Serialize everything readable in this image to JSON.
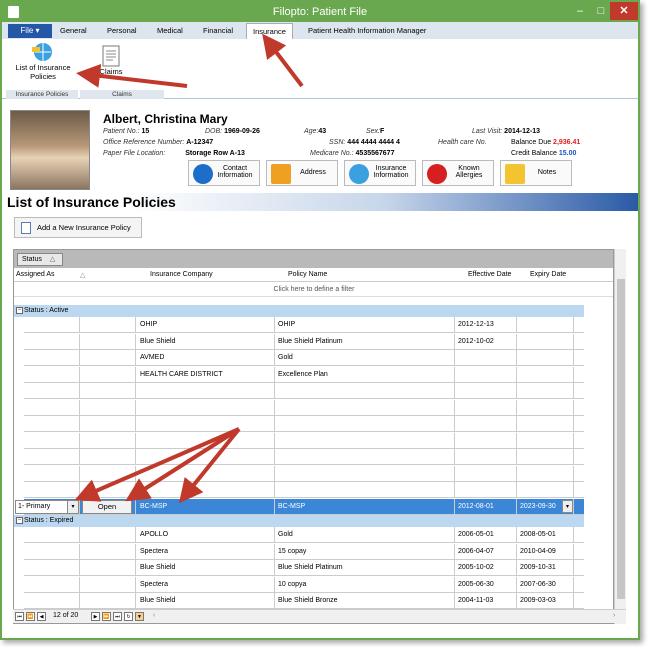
{
  "window": {
    "title": "Filopto: Patient File",
    "minimize": "–",
    "maximize": "□",
    "close": "✕"
  },
  "ribbon": {
    "file_label": "File ▾",
    "tabs": [
      "General",
      "Personal",
      "Medical",
      "Financial",
      "Insurance",
      "Patient Health Information Manager"
    ],
    "active_tab": "Insurance",
    "buttons": {
      "list_policies": "List of Insurance Policies",
      "claims": "Claims"
    },
    "groups": {
      "policies": "Insurance Policies",
      "claims": "Claims"
    }
  },
  "patient": {
    "name": "Albert, Christina Mary",
    "patient_no_label": "Patient No.:",
    "patient_no": "15",
    "dob_label": "DOB:",
    "dob": "1969-09-26",
    "age_label": "Age:",
    "age": "43",
    "sex_label": "Sex:",
    "sex": "F",
    "last_visit_label": "Last Visit:",
    "last_visit": "2014-12-13",
    "office_ref_label": "Office Reference Number:",
    "office_ref": "A-12347",
    "ssn_label": "SSN:",
    "ssn": "444 4444 4444 4",
    "health_card_label": "Health care No.",
    "balance_due_label": "Balance Due",
    "balance_due": "2,936.41",
    "paper_file_label": "Paper File Location:",
    "paper_file": "Storage Row A-13",
    "medicare_label": "Medicare No.:",
    "medicare": "4535567677",
    "credit_label": "Credit Balance",
    "credit": "15.00",
    "buttons": {
      "contact": "Contact Information",
      "address": "Address",
      "insurance": "Insurance Information",
      "allergies": "Known Allergies",
      "notes": "Notes"
    },
    "colors": {
      "balance_due": "#e02020",
      "credit": "#1a4fc2"
    }
  },
  "section_title": "List of Insurance Policies",
  "add_button": "Add a New Insurance Policy",
  "grid": {
    "group_chip": "Status",
    "group_chip_icon": "△",
    "columns": [
      "Assigned As",
      "Insurance Company",
      "Policy Name",
      "Effective Date",
      "Expiry Date"
    ],
    "sort_icon": "△",
    "filter_text": "Click here to define a filter",
    "active_group": "Status : Active",
    "active_rows": [
      {
        "company": "OHIP",
        "policy": "OHIP",
        "effective": "2012-12-13",
        "expiry": ""
      },
      {
        "company": "Blue Shield",
        "policy": "Blue Shield Platinum",
        "effective": "2012-10-02",
        "expiry": ""
      },
      {
        "company": "AVMED",
        "policy": "Gold",
        "effective": "",
        "expiry": ""
      },
      {
        "company": "HEALTH CARE DISTRICT",
        "policy": "Excellence Plan",
        "effective": "",
        "expiry": ""
      }
    ],
    "selected_row": {
      "assigned": "1- Primary",
      "open": "Open",
      "company": "BC-MSP",
      "policy": "BC-MSP",
      "effective": "2012-08-01",
      "expiry": "2023-09-30"
    },
    "expired_group": "Status : Expired",
    "expired_rows": [
      {
        "company": "APOLLO",
        "policy": "Gold",
        "effective": "2006-05-01",
        "expiry": "2008-05-01"
      },
      {
        "company": "Spectera",
        "policy": "15 copay",
        "effective": "2006-04-07",
        "expiry": "2010-04-09"
      },
      {
        "company": "Blue Shield",
        "policy": "Blue Shield Platinum",
        "effective": "2005-10-02",
        "expiry": "2009-10-31"
      },
      {
        "company": "Spectera",
        "policy": "10 copya",
        "effective": "2005-06-30",
        "expiry": "2007-06-30"
      },
      {
        "company": "Blue Shield",
        "policy": "Blue Shield Bronze",
        "effective": "2004-11-03",
        "expiry": "2009-03-03"
      }
    ]
  },
  "navigator": {
    "position": "12 of 20"
  }
}
